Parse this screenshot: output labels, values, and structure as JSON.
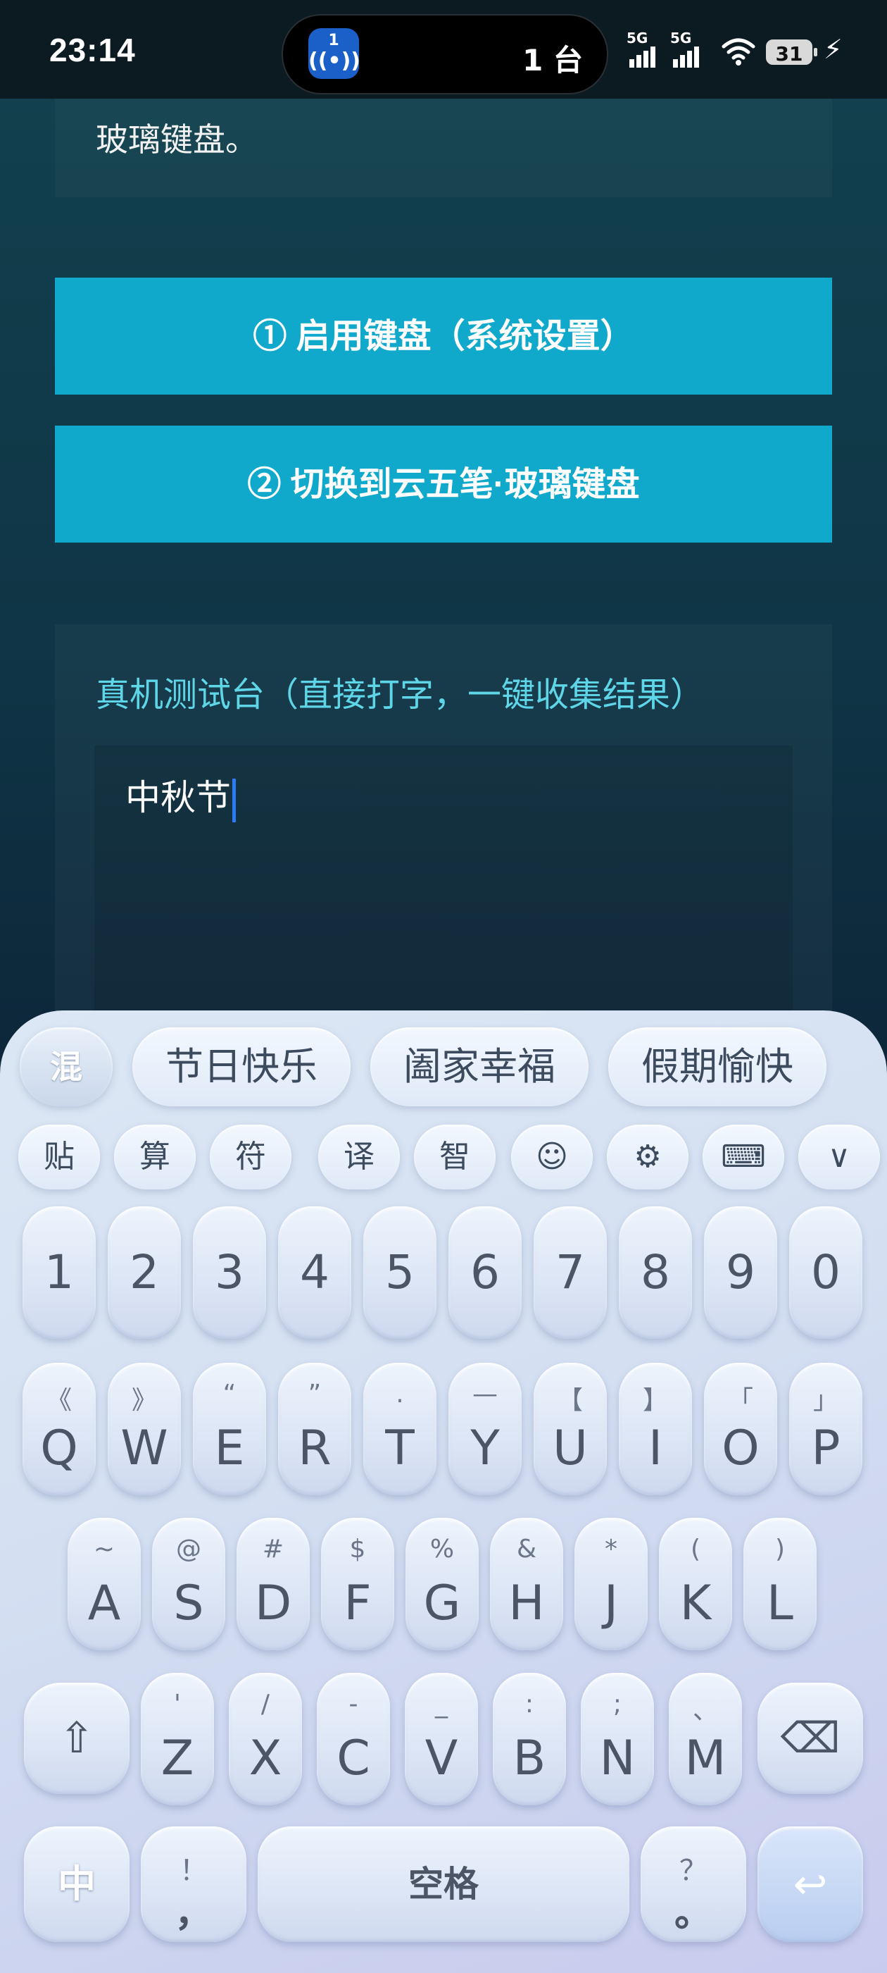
{
  "status_bar": {
    "time": "23:14",
    "island_badge": "1",
    "island_badge_icon": "((•))",
    "island_count": "1 台",
    "signal1_label": "5G",
    "signal2_label": "5G",
    "battery": "31",
    "wifi_icon": "wifi-icon",
    "charging_icon": "bolt-icon"
  },
  "content": {
    "top_card_text": "玻璃键盘。",
    "enable_button": "① 启用键盘（系统设置）",
    "switch_button": "② 切换到云五笔·玻璃键盘",
    "test_title": "真机测试台（直接打字，一键收集结果）",
    "test_input_value": "中秋节"
  },
  "keyboard": {
    "mode_label": "混",
    "candidates": [
      "节日快乐",
      "阖家幸福",
      "假期愉快"
    ],
    "tools": [
      "贴",
      "算",
      "符",
      "译",
      "智",
      "☺",
      "⚙",
      "⌨",
      "∨"
    ],
    "numbers": [
      "1",
      "2",
      "3",
      "4",
      "5",
      "6",
      "7",
      "8",
      "9",
      "0"
    ],
    "row_q": [
      {
        "main": "Q",
        "sub": "《"
      },
      {
        "main": "W",
        "sub": "》"
      },
      {
        "main": "E",
        "sub": "“"
      },
      {
        "main": "R",
        "sub": "”"
      },
      {
        "main": "T",
        "sub": "."
      },
      {
        "main": "Y",
        "sub": "—"
      },
      {
        "main": "U",
        "sub": "【"
      },
      {
        "main": "I",
        "sub": "】"
      },
      {
        "main": "O",
        "sub": "「"
      },
      {
        "main": "P",
        "sub": "」"
      }
    ],
    "row_a": [
      {
        "main": "A",
        "sub": "~"
      },
      {
        "main": "S",
        "sub": "@"
      },
      {
        "main": "D",
        "sub": "#"
      },
      {
        "main": "F",
        "sub": "$"
      },
      {
        "main": "G",
        "sub": "%"
      },
      {
        "main": "H",
        "sub": "&"
      },
      {
        "main": "J",
        "sub": "*"
      },
      {
        "main": "K",
        "sub": "("
      },
      {
        "main": "L",
        "sub": ")"
      }
    ],
    "row_z": [
      {
        "main": "Z",
        "sub": "'"
      },
      {
        "main": "X",
        "sub": "/"
      },
      {
        "main": "C",
        "sub": "-"
      },
      {
        "main": "V",
        "sub": "_"
      },
      {
        "main": "B",
        "sub": ":"
      },
      {
        "main": "N",
        "sub": ";"
      },
      {
        "main": "M",
        "sub": "、"
      }
    ],
    "shift_icon": "⇧",
    "backspace_icon": "⌫",
    "zh_label": "中",
    "comma": {
      "main": "，",
      "sub": "！"
    },
    "space_label": "空格",
    "period": {
      "main": "。",
      "sub": "？"
    },
    "enter_icon": "↩"
  }
}
